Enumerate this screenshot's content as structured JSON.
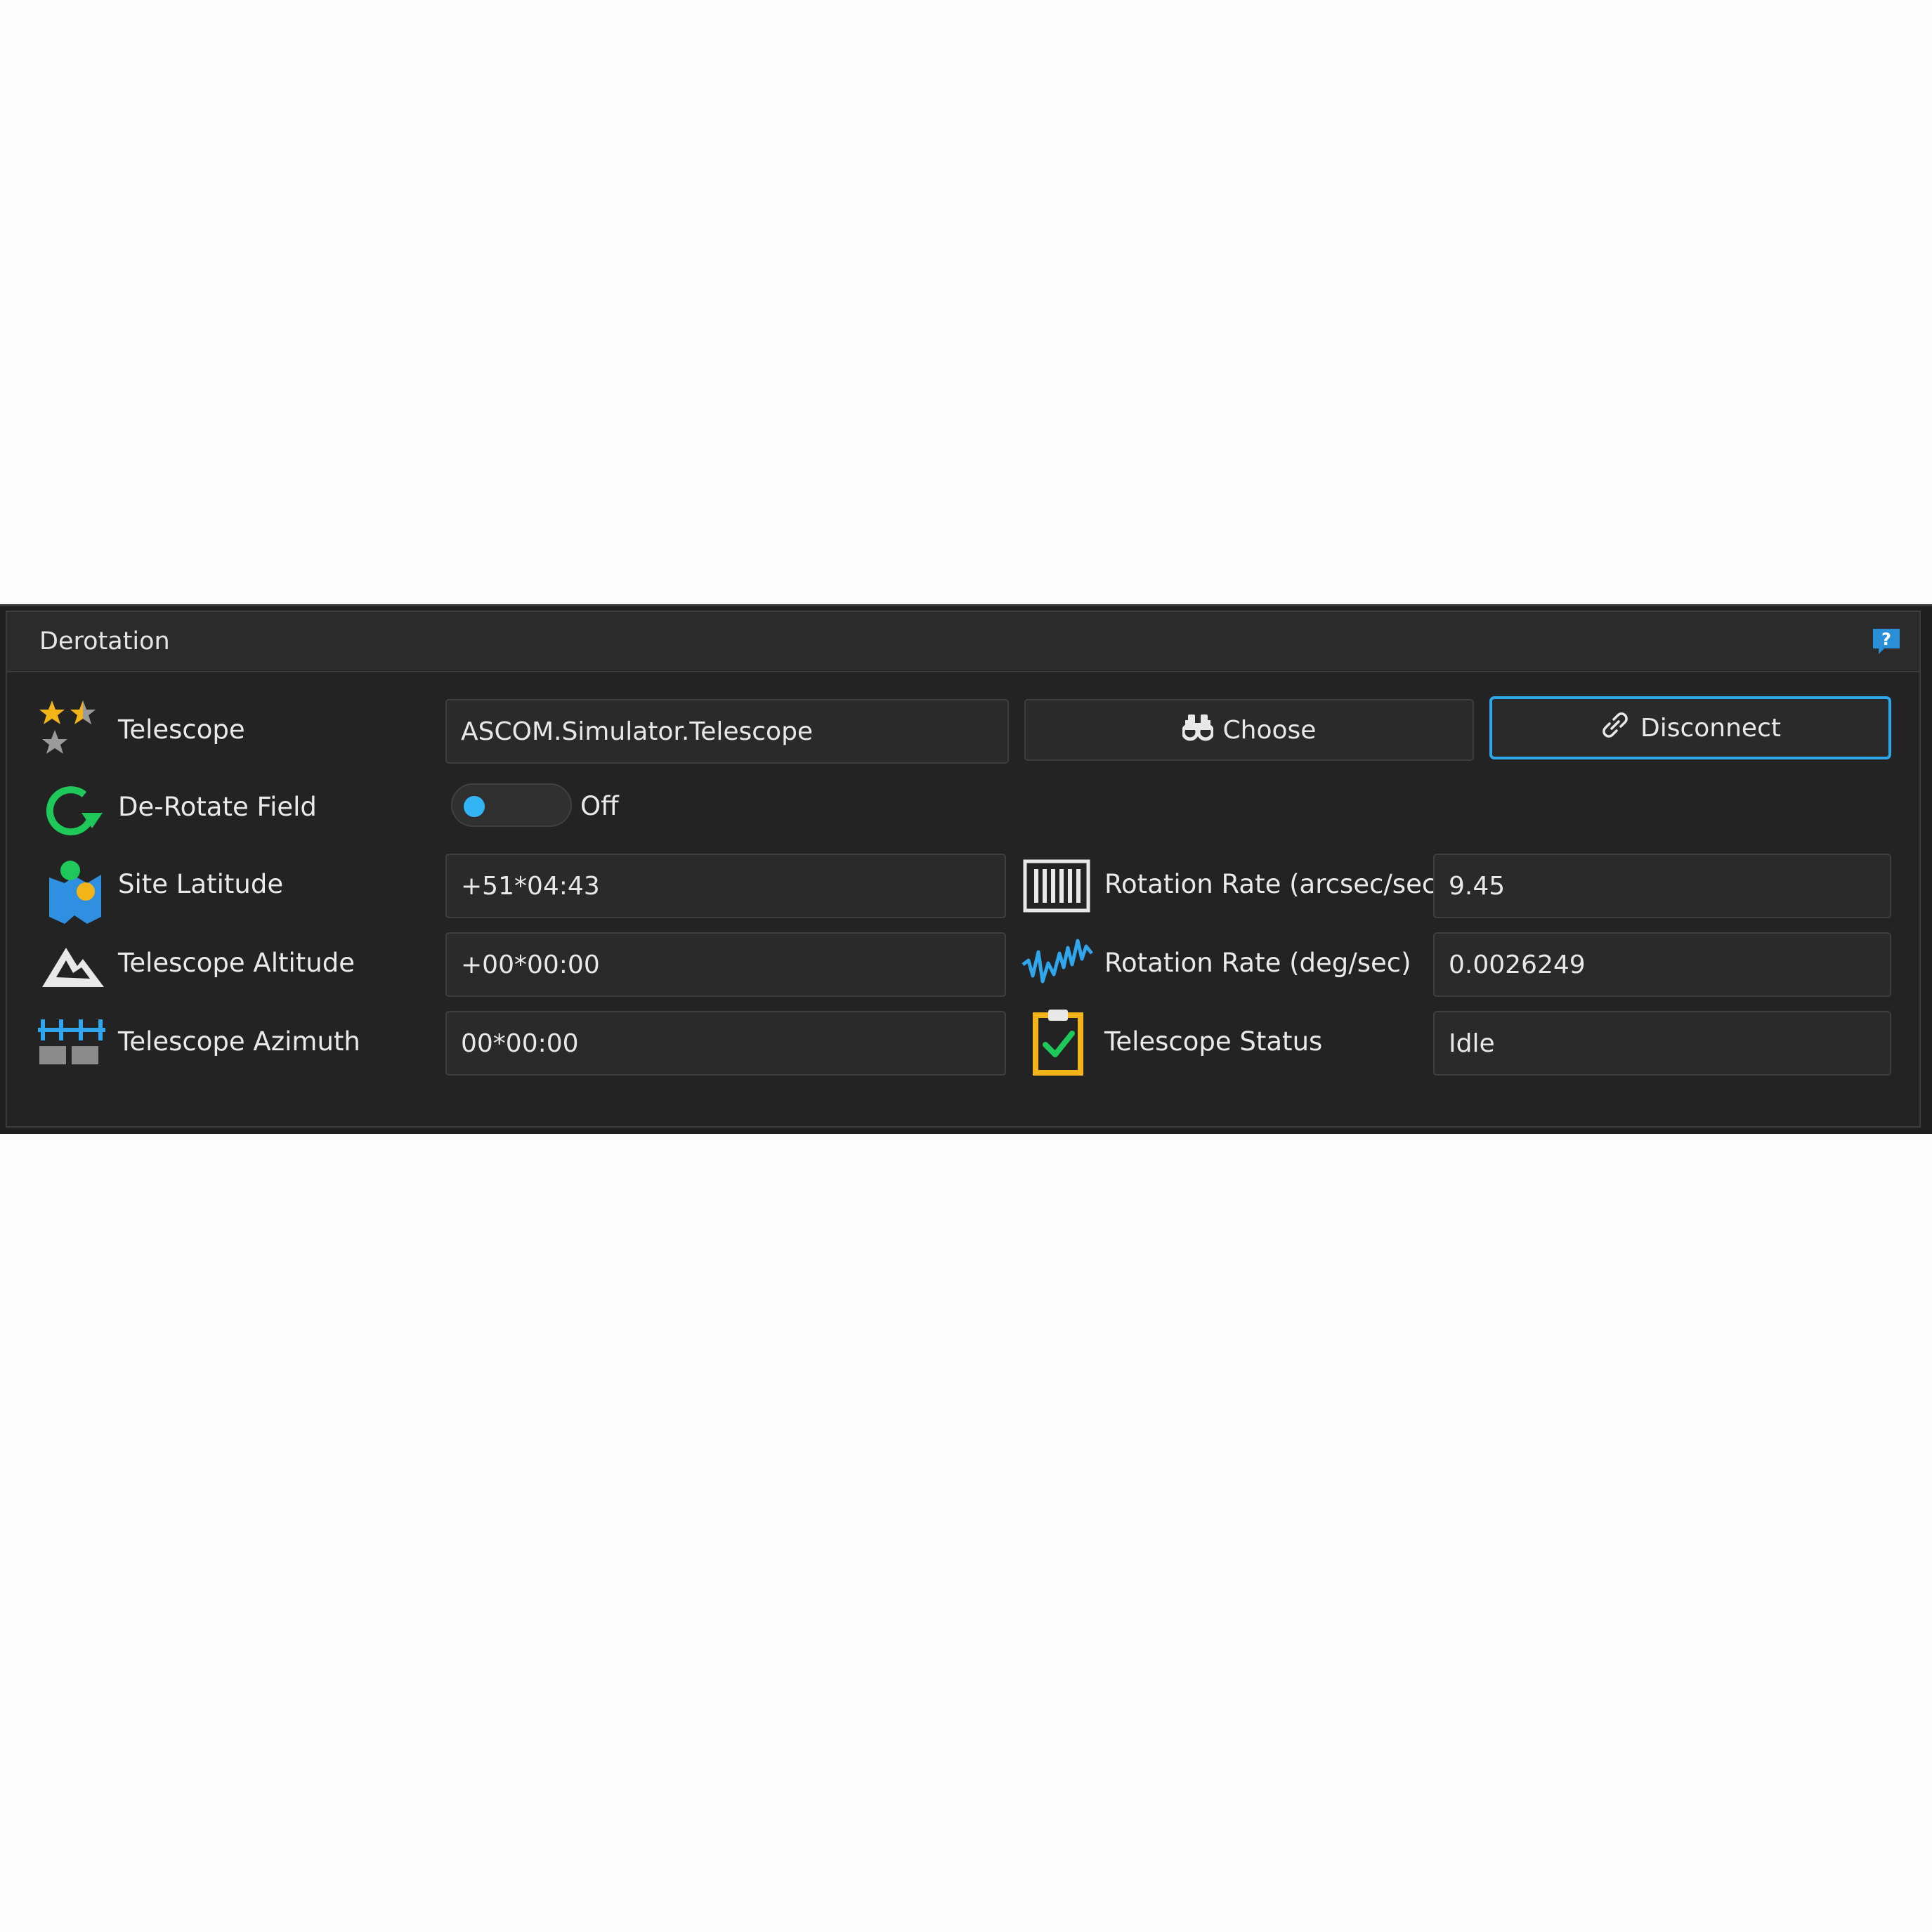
{
  "panel": {
    "title": "Derotation",
    "help_icon": "help-icon"
  },
  "telescope": {
    "label": "Telescope",
    "value": "ASCOM.Simulator.Telescope",
    "choose_label": "Choose",
    "disconnect_label": "Disconnect",
    "icon": "stars-icon"
  },
  "derotate": {
    "label": "De-Rotate Field",
    "toggle_state": "Off",
    "icon": "rotate-arrow-icon"
  },
  "site_latitude": {
    "label": "Site Latitude",
    "value": "+51*04:43",
    "icon": "map-pin-icon"
  },
  "telescope_altitude": {
    "label": "Telescope Altitude",
    "value": "+00*00:00",
    "icon": "mountain-icon"
  },
  "telescope_azimuth": {
    "label": "Telescope Azimuth",
    "value": "00*00:00",
    "icon": "azimuth-icon"
  },
  "rotation_rate_arcsec": {
    "label": "Rotation Rate (arcsec/sec)",
    "value": "9.45",
    "icon": "barcode-icon"
  },
  "rotation_rate_deg": {
    "label": "Rotation Rate (deg/sec)",
    "value": "0.0026249",
    "icon": "waveform-icon"
  },
  "telescope_status": {
    "label": "Telescope Status",
    "value": "Idle",
    "icon": "clipboard-check-icon"
  },
  "colors": {
    "accent": "#2ea8e8",
    "panel_bg": "#232323",
    "field_bg": "#2a2a2a",
    "text": "#e8e8e8"
  }
}
